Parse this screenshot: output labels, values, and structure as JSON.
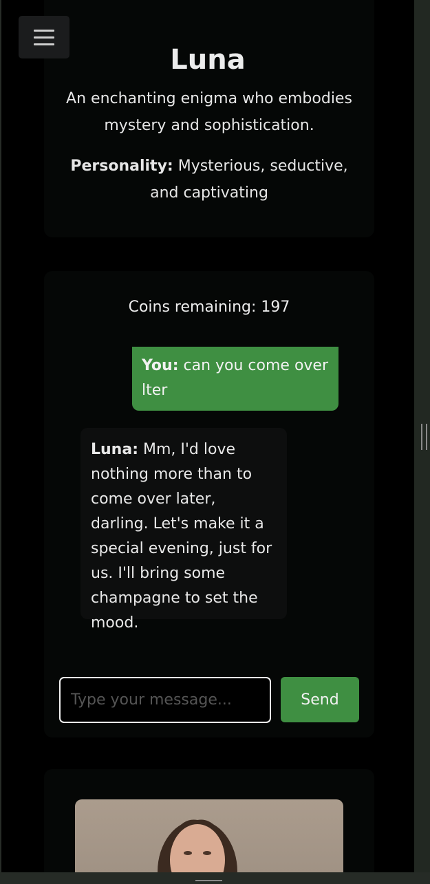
{
  "profile": {
    "name": "Luna",
    "description": "An enchanting enigma who embodies mystery and sophistication.",
    "personality_label": "Personality:",
    "personality_value": "Mysterious, seductive, and captivating"
  },
  "chat": {
    "coins_text": "Coins remaining: 197",
    "messages": [
      {
        "speaker": "You:",
        "text": "can you come over lter"
      },
      {
        "speaker": "Luna:",
        "text": "Mm, I'd love nothing more than to come over later, darling. Let's make it a special evening, just for us. I'll bring some champagne to set the mood."
      }
    ],
    "input_placeholder": "Type your message...",
    "input_value": "",
    "send_label": "Send"
  },
  "colors": {
    "accent": "#3f8f42",
    "background": "#000000",
    "card": "#050706",
    "bot_bubble": "#0d0e0e"
  },
  "icons": {
    "menu": "hamburger-icon"
  }
}
